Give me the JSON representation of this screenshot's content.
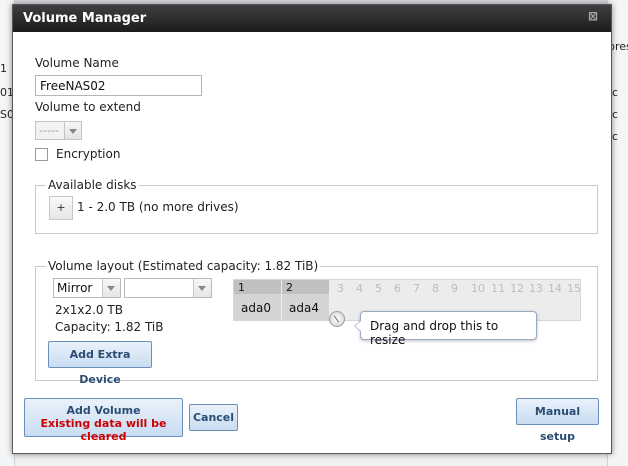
{
  "background": {
    "snippets": [
      "1",
      "01",
      "S0",
      "pres",
      "c",
      "c",
      "c"
    ]
  },
  "dialog": {
    "title": "Volume Manager",
    "close_glyph": "⊠"
  },
  "form": {
    "volume_name_label": "Volume Name",
    "volume_name_value": "FreeNAS02",
    "volume_extend_label": "Volume to extend",
    "volume_extend_value": "-----",
    "encryption_label": "Encryption",
    "encryption_checked": false
  },
  "available_disks": {
    "legend": "Available disks",
    "add_label": "+",
    "disk_group": "1 - 2.0 TB (no more drives)"
  },
  "volume_layout": {
    "legend": "Volume layout (Estimated capacity: 1.82 TiB)",
    "layout_type": "Mirror",
    "second_select_value": "",
    "geometry": "2x1x2.0 TB",
    "capacity": "Capacity: 1.82 TiB",
    "add_extra_device": "Add Extra Device",
    "grid": {
      "selected": [
        {
          "num": "1",
          "disk": "ada0"
        },
        {
          "num": "2",
          "disk": "ada4"
        }
      ],
      "inactive_numbers": [
        "3",
        "4",
        "5",
        "6",
        "7",
        "8",
        "9",
        "10",
        "11",
        "12",
        "13",
        "14",
        "15"
      ]
    },
    "tooltip": "Drag and drop this to resize"
  },
  "buttons": {
    "add_volume_line1": "Add Volume",
    "add_volume_line2": "Existing data will be cleared",
    "cancel": "Cancel",
    "manual_setup": "Manual setup"
  },
  "colors": {
    "titlebar": "#2a2a2a",
    "button_text": "#2b4d73",
    "warning": "#cc0000"
  },
  "icons": {
    "close": "close-icon",
    "dropdown": "chevron-down-icon",
    "resize_handle": "resize-handle-icon"
  }
}
